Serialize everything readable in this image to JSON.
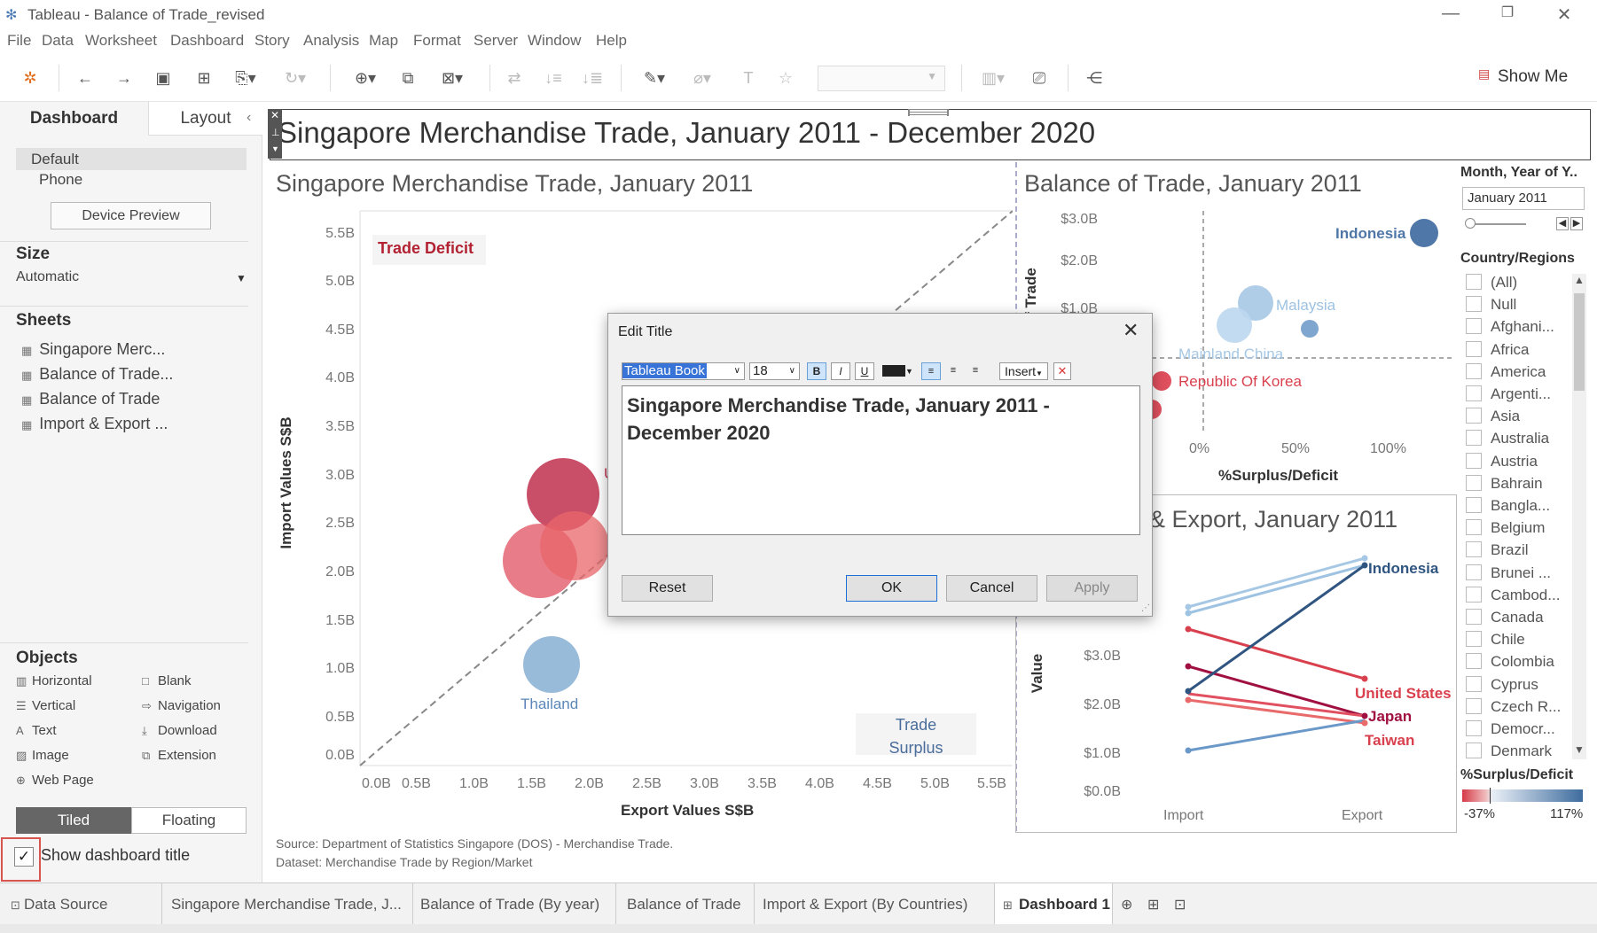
{
  "app": {
    "title": "Tableau - Balance of Trade_revised"
  },
  "menu": [
    "File",
    "Data",
    "Worksheet",
    "Dashboard",
    "Story",
    "Analysis",
    "Map",
    "Format",
    "Server",
    "Window",
    "Help"
  ],
  "toolbar": {
    "show_me": "Show Me"
  },
  "left_panel": {
    "tab_dashboard": "Dashboard",
    "tab_layout": "Layout",
    "device_default": "Default",
    "device_phone": "Phone",
    "device_preview": "Device Preview",
    "size_label": "Size",
    "size_value": "Automatic",
    "sheets_label": "Sheets",
    "sheets": [
      "Singapore Merc...",
      "Balance of Trade...",
      "Balance of Trade",
      "Import & Export ..."
    ],
    "objects_label": "Objects",
    "objects_left": [
      "Horizontal",
      "Vertical",
      "Text",
      "Image",
      "Web Page"
    ],
    "objects_right": [
      "Blank",
      "Navigation",
      "Download",
      "Extension"
    ],
    "tiled": "Tiled",
    "floating": "Floating",
    "show_title": "Show dashboard title"
  },
  "dashboard": {
    "title": "Singapore Merchandise Trade, January 2011 - December 2020",
    "source_line1": "Source: Department of Statistics Singapore (DOS) - Merchandise Trade.",
    "source_line2": "Dataset: Merchandise Trade by Region/Market"
  },
  "scatter": {
    "title": "Singapore Merchandise Trade, January 2011",
    "xlabel": "Export Values S$B",
    "ylabel": "Import Values S$B",
    "yticks": [
      "5.5B",
      "5.0B",
      "4.5B",
      "4.0B",
      "3.5B",
      "3.0B",
      "2.5B",
      "2.0B",
      "1.5B",
      "1.0B",
      "0.5B",
      "0.0B"
    ],
    "xticks": [
      "0.0B",
      "0.5B",
      "1.0B",
      "1.5B",
      "2.0B",
      "2.5B",
      "3.0B",
      "3.5B",
      "4.0B",
      "4.5B",
      "5.0B",
      "5.5B"
    ],
    "deficit": "Trade Deficit",
    "surplus1": "Trade",
    "surplus2": "Surplus",
    "thailand": "Thailand"
  },
  "balance": {
    "title": "Balance of Trade, January 2011",
    "xlabel": "%Surplus/Deficit",
    "ylabel_part": "f Trade",
    "yticks": [
      "$3.0B",
      "$2.0B",
      "$1.0B"
    ],
    "xticks": [
      "0%",
      "50%",
      "100%"
    ],
    "labels": {
      "indonesia": "Indonesia",
      "malaysia": "Malaysia",
      "china": "Mainland China",
      "korea": "Republic Of Korea"
    }
  },
  "impexp": {
    "title": "& Export, January 2011",
    "ylabel": "Value",
    "yticks": [
      "$3.0B",
      "$2.0B",
      "$1.0B",
      "$0.0B"
    ],
    "xticks": [
      "Import",
      "Export"
    ],
    "labels": {
      "indonesia": "Indonesia",
      "us": "United States",
      "japan": "Japan",
      "taiwan": "Taiwan"
    }
  },
  "filters": {
    "month_label": "Month, Year of Y..",
    "month_value": "January 2011",
    "country_label": "Country/Regions",
    "countries": [
      "(All)",
      "Null",
      "Afghani...",
      "Africa",
      "America",
      "Argenti...",
      "Asia",
      "Australia",
      "Austria",
      "Bahrain",
      "Bangla...",
      "Belgium",
      "Brazil",
      "Brunei ...",
      "Cambod...",
      "Canada",
      "Chile",
      "Colombia",
      "Cyprus",
      "Czech R...",
      "Democr...",
      "Denmark"
    ],
    "legend_title": "%Surplus/Deficit",
    "legend_min": "-37%",
    "legend_max": "117%"
  },
  "dialog": {
    "title": "Edit Title",
    "font": "Tableau Book",
    "size": "18",
    "insert": "Insert",
    "text": "Singapore Merchandise Trade, January 2011 -\nDecember 2020",
    "reset": "Reset",
    "ok": "OK",
    "cancel": "Cancel",
    "apply": "Apply"
  },
  "tabs": [
    "Data Source",
    "Singapore Merchandise Trade, J...",
    "Balance of Trade (By year)",
    "Balance of Trade",
    "Import & Export (By Countries)",
    "Dashboard 1"
  ]
}
